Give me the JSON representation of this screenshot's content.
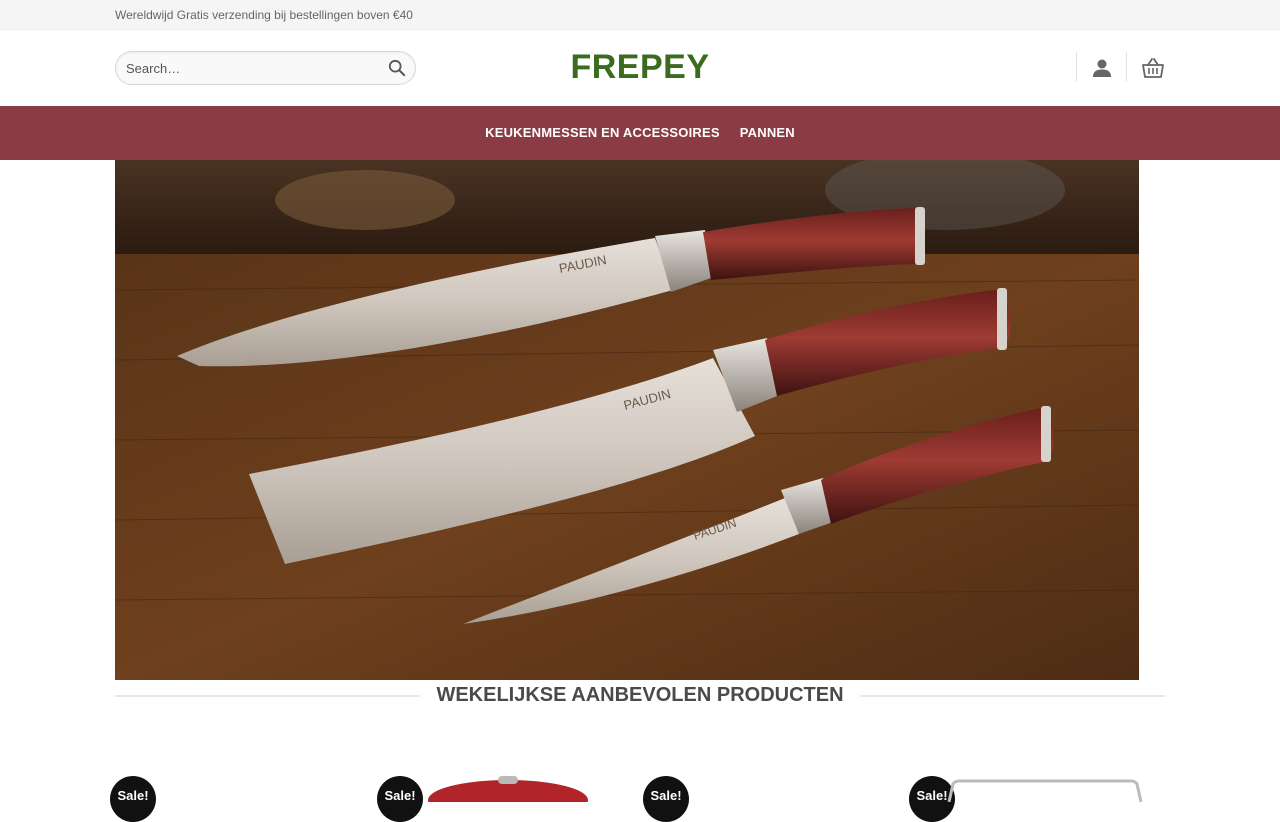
{
  "topbar": {
    "message": "Wereldwijd Gratis verzending bij bestellingen boven €40"
  },
  "header": {
    "search_placeholder": "Search…",
    "logo": "FREPEY"
  },
  "nav": {
    "items": [
      {
        "label": "KEUKENMESSEN EN ACCESSOIRES"
      },
      {
        "label": "PANNEN"
      }
    ]
  },
  "hero": {
    "brand_marks": [
      "PAUDIN",
      "PAUDIN",
      "PAUDIN"
    ]
  },
  "featured": {
    "title": "WEKELIJKSE AANBEVOLEN PRODUCTEN",
    "products": [
      {
        "badge": "Sale!"
      },
      {
        "badge": "Sale!"
      },
      {
        "badge": "Sale!"
      },
      {
        "badge": "Sale!"
      }
    ]
  },
  "colors": {
    "nav": "#8b3b44",
    "logo": "#3a6b1e",
    "badge": "#111111"
  },
  "icons": {
    "search": "search-icon",
    "account": "user-icon",
    "cart": "basket-icon"
  }
}
